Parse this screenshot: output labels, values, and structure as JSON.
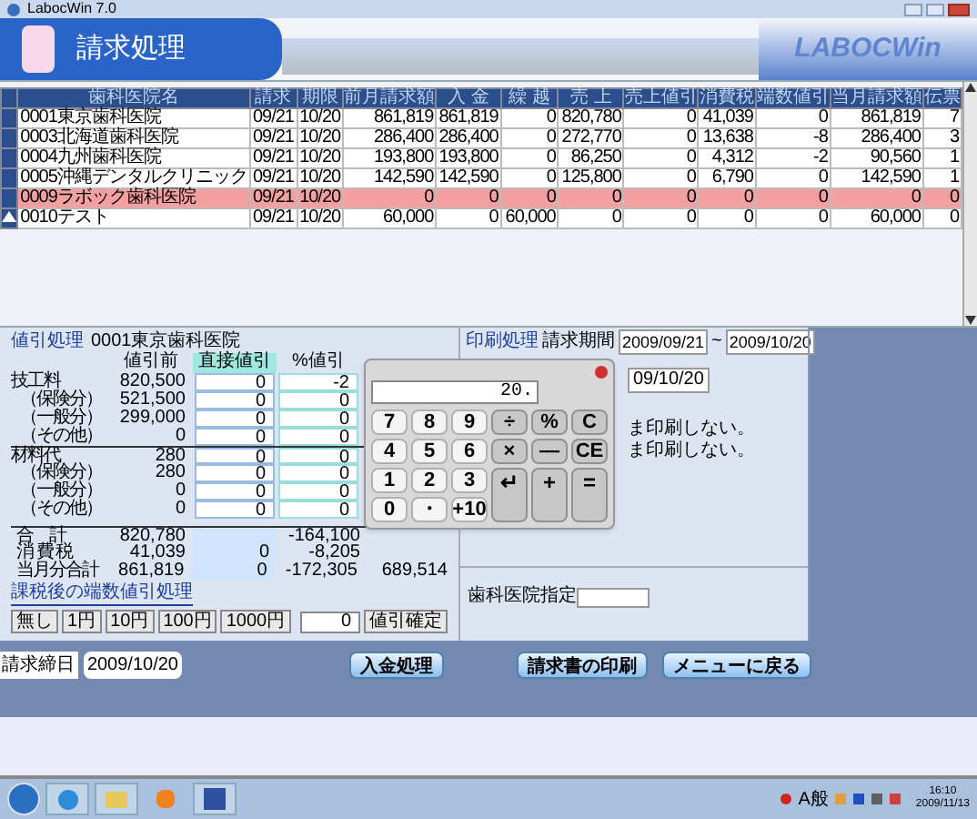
{
  "window": {
    "title": "LabocWin 7.0"
  },
  "header": {
    "title": "請求処理",
    "logo": "LABOCWin"
  },
  "table": {
    "columns": [
      "歯科医院名",
      "請求",
      "期限",
      "前月請求額",
      "入 金",
      "繰 越",
      "売 上",
      "売上値引",
      "消費税",
      "端数値引",
      "当月請求額",
      "伝票"
    ],
    "rows": [
      {
        "current": false,
        "highlighted": false,
        "cells": [
          "0001東京歯科医院",
          "09/21",
          "10/20",
          "861,819",
          "861,819",
          "0",
          "820,780",
          "0",
          "41,039",
          "0",
          "861,819",
          "7"
        ]
      },
      {
        "current": false,
        "highlighted": false,
        "cells": [
          "0003北海道歯科医院",
          "09/21",
          "10/20",
          "286,400",
          "286,400",
          "0",
          "272,770",
          "0",
          "13,638",
          "-8",
          "286,400",
          "3"
        ]
      },
      {
        "current": false,
        "highlighted": false,
        "cells": [
          "0004九州歯科医院",
          "09/21",
          "10/20",
          "193,800",
          "193,800",
          "0",
          "86,250",
          "0",
          "4,312",
          "-2",
          "90,560",
          "1"
        ]
      },
      {
        "current": false,
        "highlighted": false,
        "cells": [
          "0005沖縄デンタルクリニック",
          "09/21",
          "10/20",
          "142,590",
          "142,590",
          "0",
          "125,800",
          "0",
          "6,790",
          "0",
          "142,590",
          "1"
        ]
      },
      {
        "current": false,
        "highlighted": true,
        "cells": [
          "0009ラボック歯科医院",
          "09/21",
          "10/20",
          "0",
          "0",
          "0",
          "0",
          "0",
          "0",
          "0",
          "0",
          "0"
        ]
      },
      {
        "current": true,
        "highlighted": false,
        "cells": [
          "0010テスト",
          "09/21",
          "10/20",
          "60,000",
          "0",
          "60,000",
          "0",
          "0",
          "0",
          "0",
          "60,000",
          "0"
        ]
      }
    ]
  },
  "discount": {
    "title": "値引処理",
    "clinic": "0001東京歯科医院",
    "headers": [
      "値引前",
      "直接値引",
      "%値引"
    ],
    "rows": [
      {
        "kind": "group",
        "label": "技工料",
        "before": "820,500",
        "direct": "0",
        "percent": "-2"
      },
      {
        "kind": "sub",
        "label": "（保険分）",
        "before": "521,500",
        "direct": "0",
        "percent": "0"
      },
      {
        "kind": "sub",
        "label": "（一般分）",
        "before": "299,000",
        "direct": "0",
        "percent": "0"
      },
      {
        "kind": "sub",
        "label": "（その他）",
        "before": "0",
        "direct": "0",
        "percent": "0"
      },
      {
        "kind": "group",
        "label": "材料代",
        "before": "280",
        "direct": "0",
        "percent": "0"
      },
      {
        "kind": "sub",
        "label": "（保険分）",
        "before": "280",
        "direct": "0",
        "percent": "0"
      },
      {
        "kind": "sub",
        "label": "（一般分）",
        "before": "0",
        "direct": "0",
        "percent": "0"
      },
      {
        "kind": "sub",
        "label": "（その他）",
        "before": "0",
        "direct": "0",
        "percent": "0"
      },
      {
        "kind": "total",
        "label": "合　計",
        "before": "820,780",
        "percent": "-164,100"
      },
      {
        "kind": "total",
        "label": "消 費 税",
        "before": "41,039",
        "direct": "0",
        "percent": "-8,205"
      },
      {
        "kind": "total",
        "label": "当月分合計",
        "before": "861,819",
        "direct": "0",
        "percent": "-172,305",
        "after": "689,514"
      }
    ],
    "rounding_title": "課税後の端数値引処理",
    "rounding_buttons": [
      "無し",
      "1円",
      "10円",
      "100円",
      "1000円"
    ],
    "rounding_value": "0",
    "confirm": "値引確定"
  },
  "print": {
    "title": "印刷処理",
    "period_label": "請求期間",
    "period_from": "2009/09/21",
    "tilde": "~",
    "period_to": "2009/10/20",
    "date_partial": "09/10/20",
    "notes": [
      "ま印刷しない。",
      "ま印刷しない。"
    ],
    "clinic_label": "歯科医院指定"
  },
  "calculator": {
    "display": "20.",
    "keys": [
      {
        "kind": "digit",
        "label": "7"
      },
      {
        "kind": "digit",
        "label": "8"
      },
      {
        "kind": "digit",
        "label": "9"
      },
      {
        "kind": "op",
        "label": "÷"
      },
      {
        "kind": "op",
        "label": "%"
      },
      {
        "kind": "op",
        "label": "C"
      },
      {
        "kind": "digit",
        "label": "4"
      },
      {
        "kind": "digit",
        "label": "5"
      },
      {
        "kind": "digit",
        "label": "6"
      },
      {
        "kind": "op",
        "label": "×"
      },
      {
        "kind": "op",
        "label": "—"
      },
      {
        "kind": "op",
        "label": "CE"
      },
      {
        "kind": "digit",
        "label": "1"
      },
      {
        "kind": "digit",
        "label": "2"
      },
      {
        "kind": "digit",
        "label": "3"
      },
      {
        "kind": "tall",
        "label": "↵"
      },
      {
        "kind": "tall",
        "label": "+"
      },
      {
        "kind": "tall",
        "label": "="
      },
      {
        "kind": "digit",
        "label": "0"
      },
      {
        "kind": "digit",
        "label": "・"
      },
      {
        "kind": "digit",
        "label": "+10"
      }
    ]
  },
  "footer": {
    "closing_label": "請求締日",
    "closing_date": "2009/10/20",
    "buttons": [
      "入金処理",
      "請求書の印刷",
      "メニューに戻る"
    ]
  },
  "taskbar": {
    "ime": "A般",
    "time": "16:10",
    "date": "2009/11/13"
  }
}
